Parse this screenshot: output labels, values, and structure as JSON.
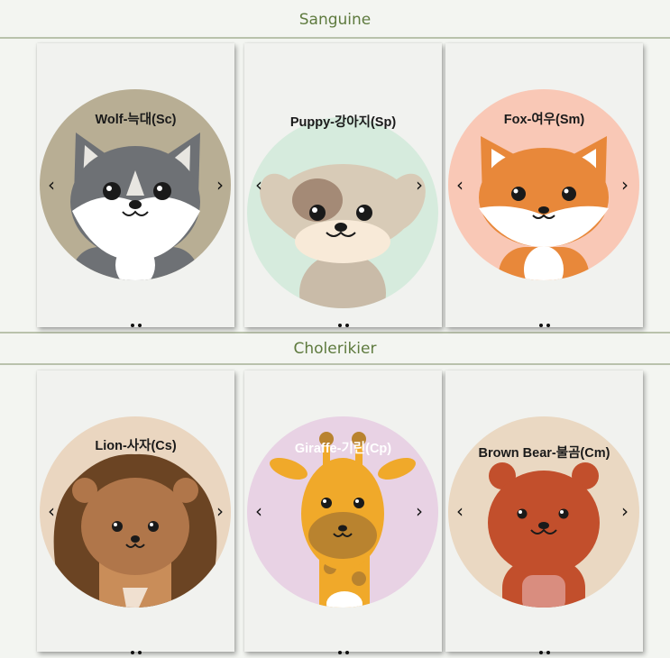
{
  "sections": [
    {
      "title": "Sanguine"
    },
    {
      "title": "Cholerikier"
    }
  ],
  "cards": [
    {
      "label": "Wolf-늑대(Sc)",
      "bg": "#b8ae94",
      "icon": "wolf-icon"
    },
    {
      "label": "Puppy-강아지(Sp)",
      "bg": "#d6ebdd",
      "icon": "puppy-icon"
    },
    {
      "label": "Fox-여우(Sm)",
      "bg": "#f9c8b6",
      "icon": "fox-icon"
    },
    {
      "label": "Lion-사자(Cs)",
      "bg": "#ead6c0",
      "icon": "lion-icon"
    },
    {
      "label": "Giraffe-기린(Cp)",
      "bg": "#e8d2e4",
      "icon": "giraffe-icon"
    },
    {
      "label": "Brown Bear-불곰(Cm)",
      "bg": "#ead8c2",
      "icon": "bear-icon"
    }
  ],
  "controls": {
    "prev": "‹",
    "next": "›"
  }
}
